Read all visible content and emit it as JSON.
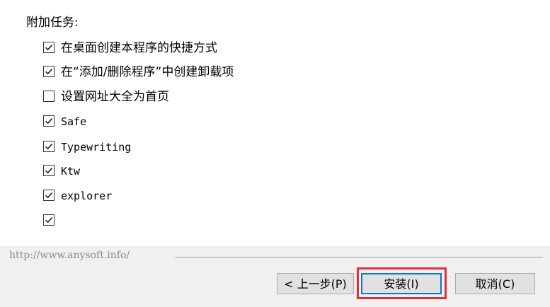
{
  "section_title": "附加任务:",
  "options": [
    {
      "label": "在桌面创建本程序的快捷方式",
      "checked": true
    },
    {
      "label": "在“添加/删除程序”中创建卸载项",
      "checked": true
    },
    {
      "label": "设置网址大全为首页",
      "checked": false
    },
    {
      "label": "Safe",
      "checked": true
    },
    {
      "label": "Typewriting",
      "checked": true
    },
    {
      "label": "Ktw",
      "checked": true
    },
    {
      "label": "explorer",
      "checked": true
    },
    {
      "label": "",
      "checked": true
    }
  ],
  "footer": {
    "url": "http://www.anysoft.info/"
  },
  "buttons": {
    "back": "< 上一步(P)",
    "install": "安装(I)",
    "cancel": "取消(C)"
  },
  "colors": {
    "highlight": "#e0303a",
    "default_button_border": "#0078d7"
  }
}
